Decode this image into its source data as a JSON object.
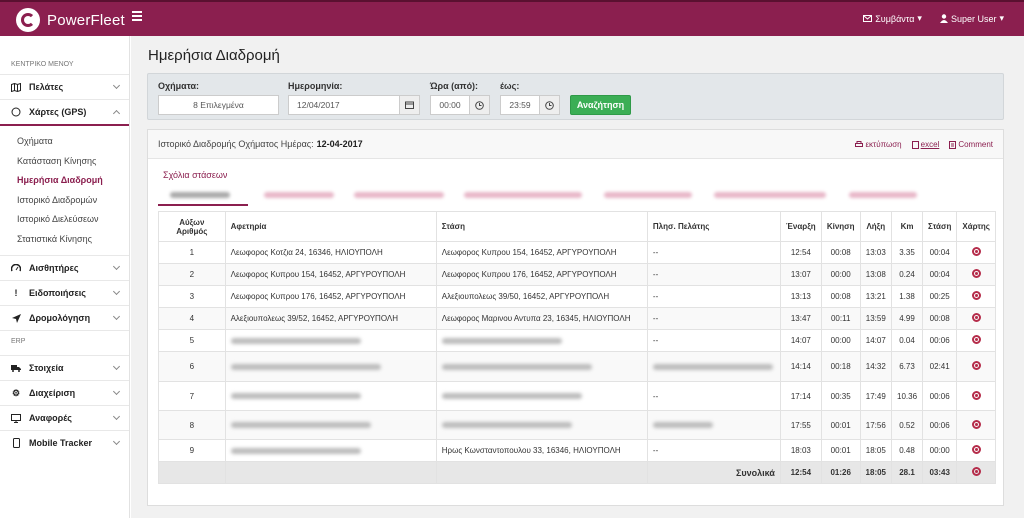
{
  "app": {
    "brand": "PowerFleet",
    "alerts": "Συμβάντα",
    "user": "Super User"
  },
  "sidebar": {
    "header": "ΚΕΝΤΡΙΚΟ ΜΕΝΟΥ",
    "items_top": [
      {
        "label": "Πελάτες",
        "icon": "map-icon"
      },
      {
        "label": "Χάρτες (GPS)",
        "icon": "circle-icon"
      }
    ],
    "submenu": [
      "Οχήματα",
      "Κατάσταση Κίνησης",
      "Ημερήσια Διαδρομή",
      "Ιστορικό Διαδρομών",
      "Ιστορικό Διελεύσεων",
      "Στατιστικά Κίνησης"
    ],
    "items_mid": [
      {
        "label": "Αισθητήρες",
        "icon": "gauge-icon"
      },
      {
        "label": "Ειδοποιήσεις",
        "icon": "exclamation-icon"
      },
      {
        "label": "Δρομολόγηση",
        "icon": "location-arrow-icon"
      }
    ],
    "erp_header": "ERP",
    "items_erp": [
      {
        "label": "Στοιχεία",
        "icon": "truck-icon"
      },
      {
        "label": "Διαχείριση",
        "icon": "gear-icon"
      },
      {
        "label": "Αναφορές",
        "icon": "monitor-icon"
      },
      {
        "label": "Mobile Tracker",
        "icon": "mobile-icon"
      }
    ]
  },
  "page": {
    "title": "Ημερήσια Διαδρομή"
  },
  "filter": {
    "vehicles_label": "Οχήματα:",
    "vehicles_value": "8 Επιλεγμένα",
    "date_label": "Ημερομηνία:",
    "date_value": "12/04/2017",
    "time_from_label": "Ώρα (από):",
    "time_from_value": "00:00",
    "time_to_label": "έως:",
    "time_to_value": "23:59",
    "search_button": "Αναζήτηση"
  },
  "panel": {
    "heading": "Ιστορικό Διαδρομής Οχήματος Ημέρας:",
    "heading_date": "12-04-2017",
    "print": "εκτύπωση",
    "excel": "excel",
    "comment": "Comment",
    "comments_link": "Σχόλια στάσεων"
  },
  "table": {
    "headers": [
      "Αύξων Αριθμός",
      "Αφετηρία",
      "Στάση",
      "Πλησ. Πελάτης",
      "Έναρξη",
      "Κίνηση",
      "Λήξη",
      "Km",
      "Στάση",
      "Χάρτης"
    ],
    "rows": [
      {
        "n": "1",
        "from": "Λεωφορος Κοτζια 24, 16346, ΗΛΙΟΥΠΟΛΗ",
        "stop": "Λεωφορος Κυπρου 154, 16452, ΑΡΓΥΡΟΥΠΟΛΗ",
        "cust": "--",
        "start": "12:54",
        "move": "00:08",
        "end": "13:03",
        "km": "3.35",
        "idle": "00:04"
      },
      {
        "n": "2",
        "from": "Λεωφορος Κυπρου 154, 16452, ΑΡΓΥΡΟΥΠΟΛΗ",
        "stop": "Λεωφορος Κυπρου 176, 16452, ΑΡΓΥΡΟΥΠΟΛΗ",
        "cust": "--",
        "start": "13:07",
        "move": "00:00",
        "end": "13:08",
        "km": "0.24",
        "idle": "00:04"
      },
      {
        "n": "3",
        "from": "Λεωφορος Κυπρου 176, 16452, ΑΡΓΥΡΟΥΠΟΛΗ",
        "stop": "Αλεξιουπολεως 39/50, 16452, ΑΡΓΥΡΟΥΠΟΛΗ",
        "cust": "--",
        "start": "13:13",
        "move": "00:08",
        "end": "13:21",
        "km": "1.38",
        "idle": "00:25"
      },
      {
        "n": "4",
        "from": "Αλεξιουπολεως 39/52, 16452, ΑΡΓΥΡΟΥΠΟΛΗ",
        "stop": "Λεωφορος Μαρινου Αντυπα 23, 16345, ΗΛΙΟΥΠΟΛΗ",
        "cust": "--",
        "start": "13:47",
        "move": "00:11",
        "end": "13:59",
        "km": "4.99",
        "idle": "00:08"
      },
      {
        "n": "5",
        "from": "",
        "stop": "",
        "cust": "--",
        "start": "14:07",
        "move": "00:00",
        "end": "14:07",
        "km": "0.04",
        "idle": "00:06"
      },
      {
        "n": "6",
        "from": "",
        "stop": "",
        "cust": "",
        "start": "14:14",
        "move": "00:18",
        "end": "14:32",
        "km": "6.73",
        "idle": "02:41"
      },
      {
        "n": "7",
        "from": "",
        "stop": "",
        "cust": "--",
        "start": "17:14",
        "move": "00:35",
        "end": "17:49",
        "km": "10.36",
        "idle": "00:06"
      },
      {
        "n": "8",
        "from": "",
        "stop": "",
        "cust": "",
        "start": "17:55",
        "move": "00:01",
        "end": "17:56",
        "km": "0.52",
        "idle": "00:06"
      },
      {
        "n": "9",
        "from": "",
        "stop": "Ηρως Κωνσταντοπουλου 33, 16346, ΗΛΙΟΥΠΟΛΗ",
        "cust": "--",
        "start": "18:03",
        "move": "00:01",
        "end": "18:05",
        "km": "0.48",
        "idle": "00:00"
      }
    ],
    "totals": {
      "label": "Συνολικά",
      "start": "12:54",
      "move": "01:26",
      "end": "18:05",
      "km": "28.1",
      "idle": "03:43"
    }
  },
  "colors": {
    "brand": "#8b1f4f",
    "success": "#3bae55"
  }
}
